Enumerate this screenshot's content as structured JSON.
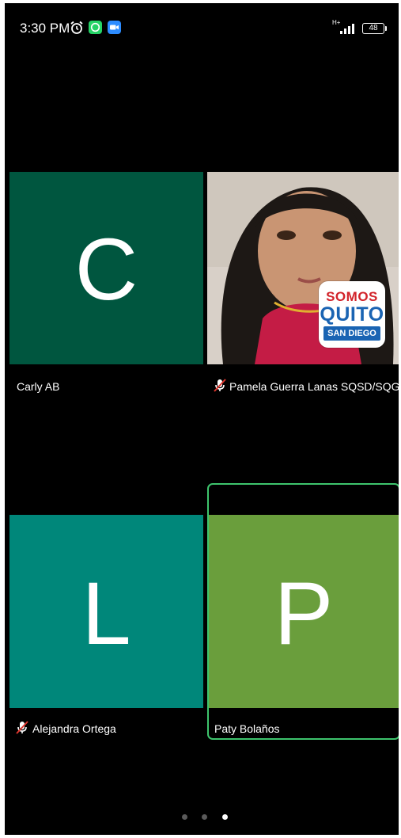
{
  "status_bar": {
    "time": "3:30 PM",
    "network_type": "H+",
    "battery_level": "48",
    "icons": [
      "alarm-icon",
      "whatsapp-icon",
      "zoom-icon",
      "signal-icon",
      "battery-icon"
    ]
  },
  "participants": [
    {
      "name": "Carly AB",
      "initial": "C",
      "tile_color": "#00563f",
      "muted": false
    },
    {
      "name": "Pamela Guerra Lanas SQSD/SQG",
      "initial": "",
      "tile_color": "#b3172f",
      "muted": true,
      "video": true,
      "logo": {
        "line1": "SOMOS",
        "line2": "QUITO",
        "line3": "SAN DIEGO"
      }
    },
    {
      "name": "Alejandra Ortega",
      "initial": "L",
      "tile_color": "#00877a",
      "muted": true
    },
    {
      "name": "Paty Bolaños",
      "initial": "P",
      "tile_color": "#6a9e3c",
      "muted": false,
      "active_speaker": true
    }
  ],
  "pagination": {
    "total": 3,
    "current": 3
  },
  "colors": {
    "active_speaker_border": "#3ec46d",
    "background": "#000000"
  }
}
